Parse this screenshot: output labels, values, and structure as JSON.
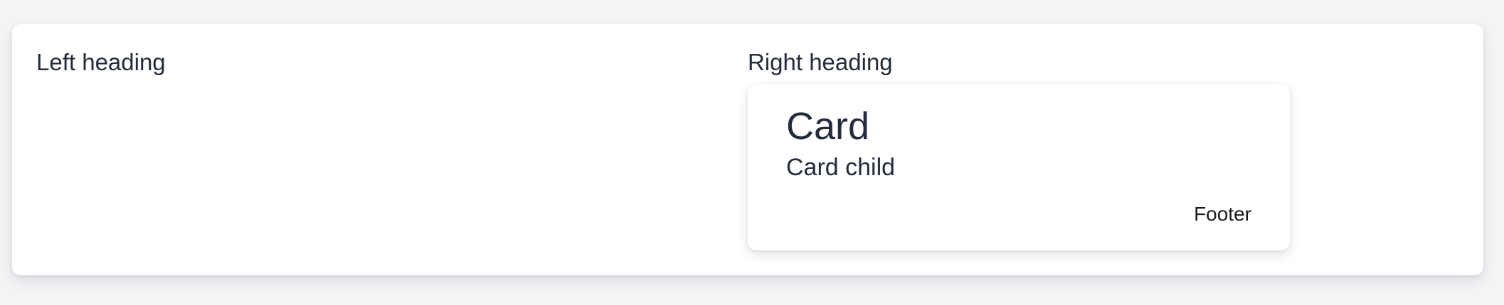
{
  "left": {
    "heading": "Left heading"
  },
  "right": {
    "heading": "Right heading",
    "card": {
      "title": "Card",
      "child": "Card child",
      "footer": "Footer"
    }
  }
}
